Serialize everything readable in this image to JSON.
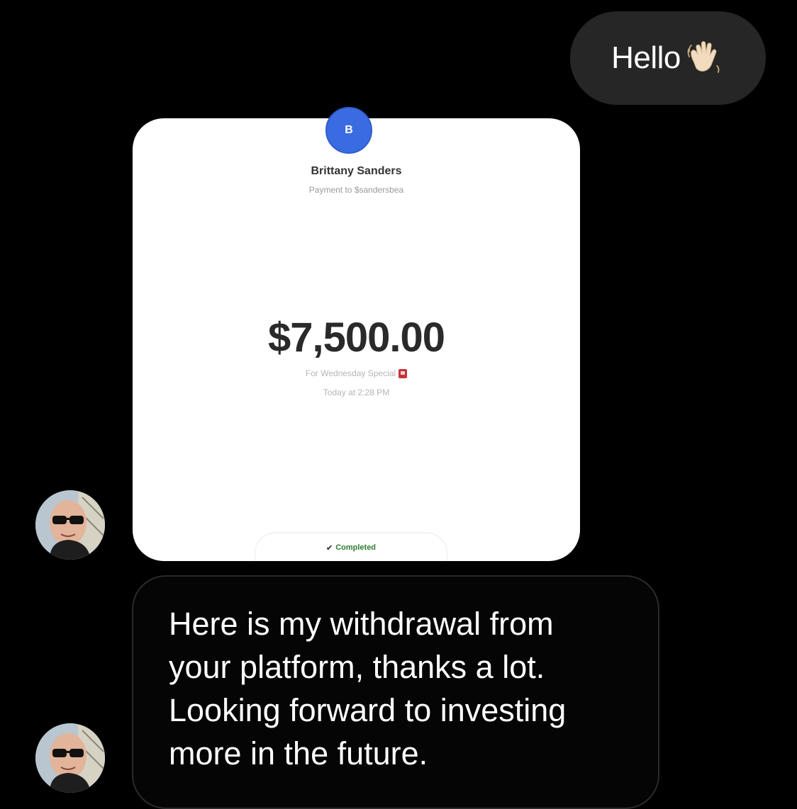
{
  "messages": {
    "outgoing": {
      "text": "Hello",
      "emoji_icon": "waving-hand-icon"
    },
    "payment_card": {
      "avatar_initial": "B",
      "name": "Brittany Sanders",
      "subtitle": "Payment to $sandersbea",
      "amount": "$7,500.00",
      "note": "For Wednesday Special",
      "note_icon": "ticket-icon",
      "time": "Today at 2:28 PM",
      "status": "Completed",
      "status_icon": "check-icon"
    },
    "incoming": {
      "text": "Here is my withdrawal from your platform, thanks a lot. Looking forward to investing more in the future."
    }
  },
  "colors": {
    "background": "#000000",
    "outgoing_bubble": "#262626",
    "card_avatar": "#3b6be0",
    "status_green": "#2e7d32"
  }
}
